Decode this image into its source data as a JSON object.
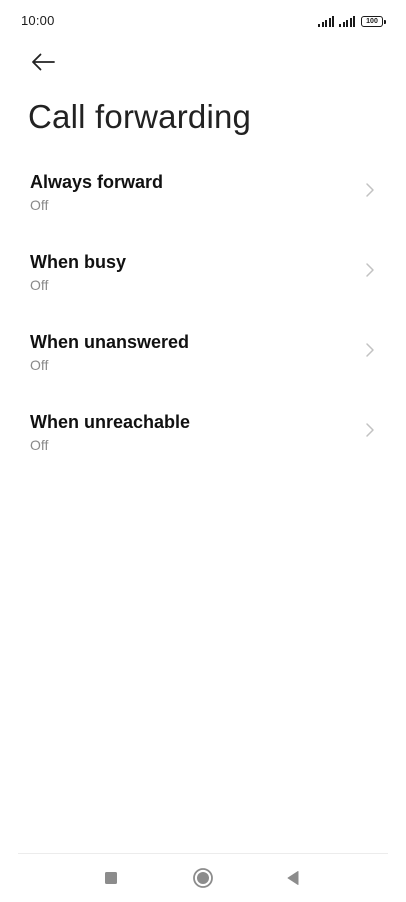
{
  "status_bar": {
    "time": "10:00",
    "battery": "100",
    "icons": [
      "signal-icon",
      "signal-icon",
      "battery-icon"
    ]
  },
  "header": {
    "back_icon": "arrow-left-icon",
    "title": "Call forwarding"
  },
  "items": [
    {
      "title": "Always forward",
      "value": "Off"
    },
    {
      "title": "When busy",
      "value": "Off"
    },
    {
      "title": "When unanswered",
      "value": "Off"
    },
    {
      "title": "When unreachable",
      "value": "Off"
    }
  ],
  "nav_bar": {
    "icons": [
      "recents-square-icon",
      "home-circle-icon",
      "back-triangle-icon"
    ]
  },
  "colors": {
    "text_primary": "#111111",
    "text_secondary": "#8a8a8a",
    "chevron": "#c2c2c2",
    "nav_icon": "#8c8c8c",
    "background": "#ffffff"
  }
}
